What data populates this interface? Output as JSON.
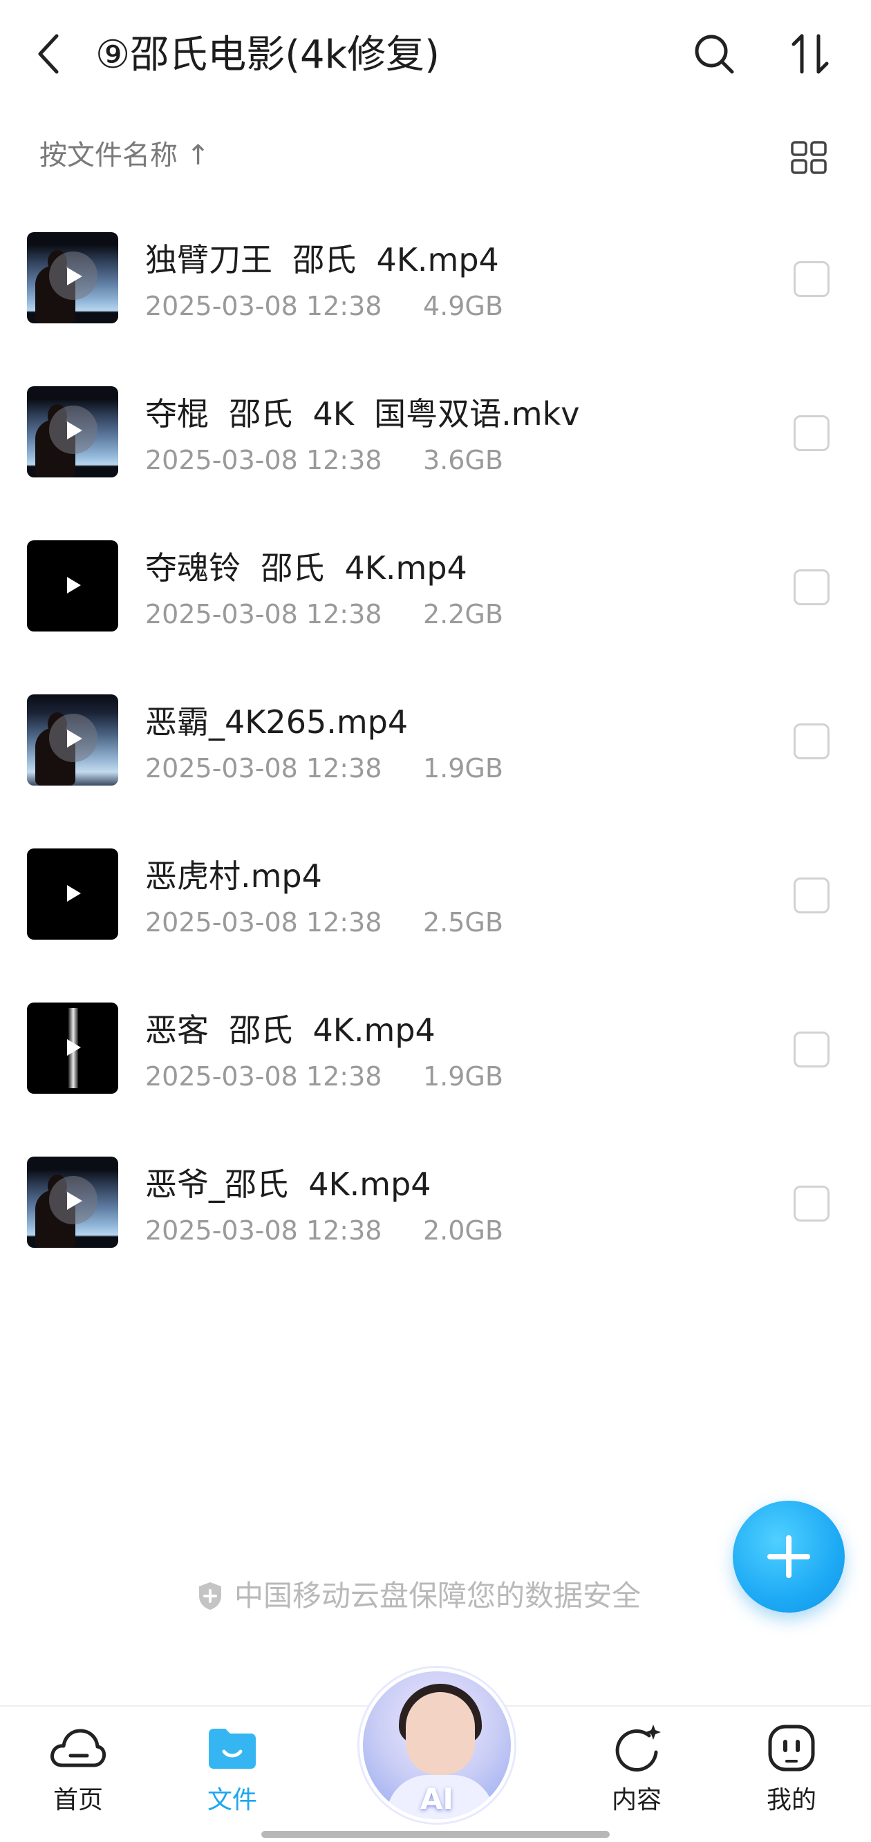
{
  "header": {
    "title": "⑨邵氏电影(4k修复)",
    "back_icon": "chevron-left-icon",
    "search_icon": "search-icon",
    "sort_icon": "sort-arrows-icon"
  },
  "sortbar": {
    "label": "按文件名称 ↑",
    "view_icon": "grid-view-icon"
  },
  "files": [
    {
      "name": "独臂刀王  邵氏  4K.mp4",
      "date": "2025-03-08 12:38",
      "size": "4.9GB",
      "thumb": "scene"
    },
    {
      "name": "夺棍  邵氏  4K  国粤双语.mkv",
      "date": "2025-03-08 12:38",
      "size": "3.6GB",
      "thumb": "scene"
    },
    {
      "name": "夺魂铃  邵氏  4K.mp4",
      "date": "2025-03-08 12:38",
      "size": "2.2GB",
      "thumb": "plain"
    },
    {
      "name": "恶霸_4K265.mp4",
      "date": "2025-03-08 12:38",
      "size": "1.9GB",
      "thumb": "scene"
    },
    {
      "name": "恶虎村.mp4",
      "date": "2025-03-08 12:38",
      "size": "2.5GB",
      "thumb": "plain"
    },
    {
      "name": "恶客  邵氏  4K.mp4",
      "date": "2025-03-08 12:38",
      "size": "1.9GB",
      "thumb": "beam"
    },
    {
      "name": "恶爷_邵氏  4K.mp4",
      "date": "2025-03-08 12:38",
      "size": "2.0GB",
      "thumb": "scene"
    }
  ],
  "secure_note": "中国移动云盘保障您的数据安全",
  "fab_icon": "plus-icon",
  "tabs": [
    {
      "label": "首页",
      "icon": "cloud-icon"
    },
    {
      "label": "文件",
      "icon": "folder-icon",
      "active": true
    },
    {
      "label": "AI",
      "icon": "ai-assistant-avatar"
    },
    {
      "label": "内容",
      "icon": "refresh-sparkle-icon"
    },
    {
      "label": "我的",
      "icon": "profile-face-icon"
    }
  ],
  "colors": {
    "accent": "#1ea6f0",
    "text_primary": "#1d1d1d",
    "text_secondary": "#9a9a9a"
  }
}
